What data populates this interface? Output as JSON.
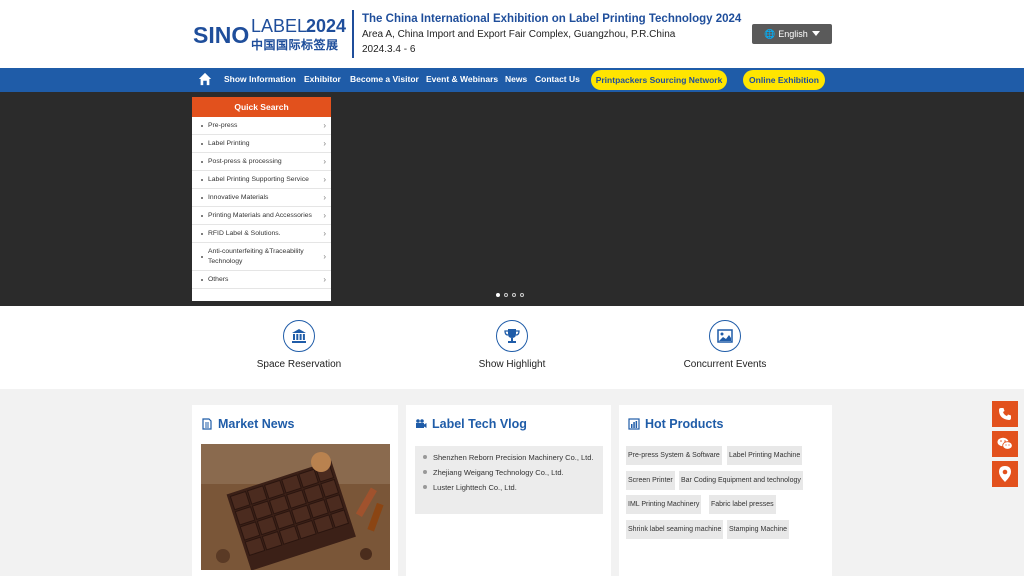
{
  "header": {
    "logo_sino": "SINO",
    "logo_label": "LABEL",
    "logo_year": "2024",
    "logo_cn": "中国国际标签展",
    "title": "The China International Exhibition on Label Printing Technology 2024",
    "venue": "Area A, China Import and Export Fair Complex, Guangzhou, P.R.China",
    "date": "2024.3.4 - 6",
    "language": "English"
  },
  "nav": {
    "items": [
      "Show Information",
      "Exhibitor",
      "Become a Visitor",
      "Event & Webinars",
      "News",
      "Contact Us"
    ],
    "pills": [
      "Printpackers Sourcing Network",
      "Online Exhibition"
    ]
  },
  "quick_search": {
    "title": "Quick Search",
    "items": [
      "Pre-press",
      "Label Printing",
      "Post-press & processing",
      "Label Printing Supporting Service",
      "Innovative Materials",
      "Printing Materials and Accessories",
      "RFID Label & Solutions.",
      "Anti-counterfeiting &Traceability Technology",
      "Others"
    ],
    "arrow": "›"
  },
  "carousel": {
    "slides": 4,
    "active": 0
  },
  "features": [
    "Space Reservation",
    "Show Highlight",
    "Concurrent Events"
  ],
  "panels": {
    "market_news": {
      "title": "Market News"
    },
    "vlog": {
      "title": "Label Tech Vlog",
      "items": [
        "Shenzhen Reborn Precision Machinery Co., Ltd.",
        "Zhejiang Weigang Technology Co., Ltd.",
        "Luster Lighttech Co., Ltd."
      ]
    },
    "hot_products": {
      "title": "Hot Products",
      "tags": [
        "Pre-press System & Software",
        "Label Printing Machine",
        "Screen Printer",
        "Bar Coding Equipment and technology",
        "IML Printing Machinery",
        "Fabric label presses",
        "Shrink label seaming machine",
        "Stamping Machine"
      ]
    }
  },
  "colors": {
    "brand_blue": "#1f5ca8",
    "accent_orange": "#e2511d",
    "pill_yellow": "#ffe500"
  }
}
